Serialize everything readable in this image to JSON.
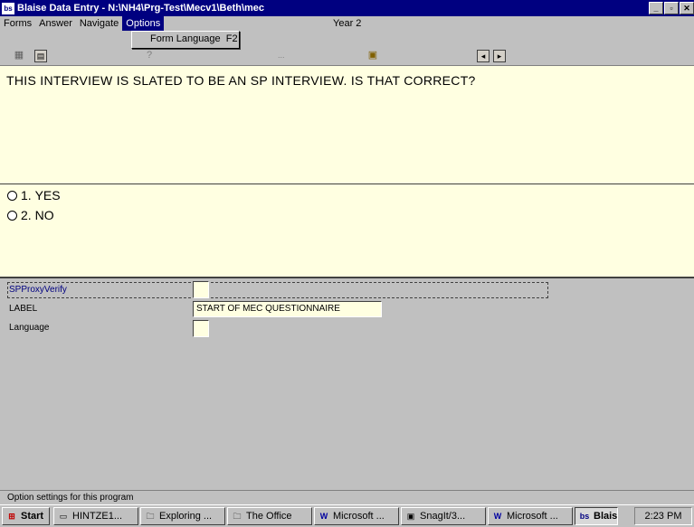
{
  "window": {
    "title": "Blaise Data Entry - N:\\NH4\\Prg-Test\\Mecv1\\Beth\\mec",
    "app_icon": "bs-icon",
    "buttons": [
      "minimize",
      "restore",
      "close"
    ]
  },
  "menu": {
    "items": [
      {
        "label": "Forms"
      },
      {
        "label": "Answer"
      },
      {
        "label": "Navigate"
      },
      {
        "label": "Options"
      }
    ],
    "info": "Year 2",
    "open_menu": {
      "items": [
        {
          "label": "Form Language",
          "shortcut": "F2"
        }
      ]
    }
  },
  "toolbar": {
    "icons": [
      "copy-icon",
      "doc-icon",
      "help-icon",
      "dots",
      "search-doc-icon",
      "nav-prev-icon",
      "nav-next-icon"
    ],
    "dots": "..."
  },
  "question": {
    "text": "THIS INTERVIEW IS SLATED TO BE AN SP INTERVIEW. IS THAT CORRECT?"
  },
  "answers": [
    {
      "code": "1.",
      "label": "YES"
    },
    {
      "code": "2.",
      "label": "NO"
    }
  ],
  "fields": [
    {
      "name": "SPProxyVerify",
      "value": ""
    },
    {
      "name": "LABEL",
      "value": "START OF MEC QUESTIONNAIRE"
    },
    {
      "name": "Language",
      "value": ""
    }
  ],
  "status": {
    "text": "Option settings for this program"
  },
  "taskbar": {
    "start": "Start",
    "tasks": [
      {
        "label": "HINTZE1..."
      },
      {
        "label": "Exploring ..."
      },
      {
        "label": "The Office"
      },
      {
        "label": "Microsoft ..."
      },
      {
        "label": "SnagIt/3..."
      },
      {
        "label": "Microsoft ..."
      },
      {
        "label": "Blaise ..."
      }
    ],
    "clock": "2:23 PM"
  },
  "colors": {
    "titlebar": "#000080",
    "panel_bg": "#ffffe1",
    "chrome": "#c0c0c0"
  }
}
